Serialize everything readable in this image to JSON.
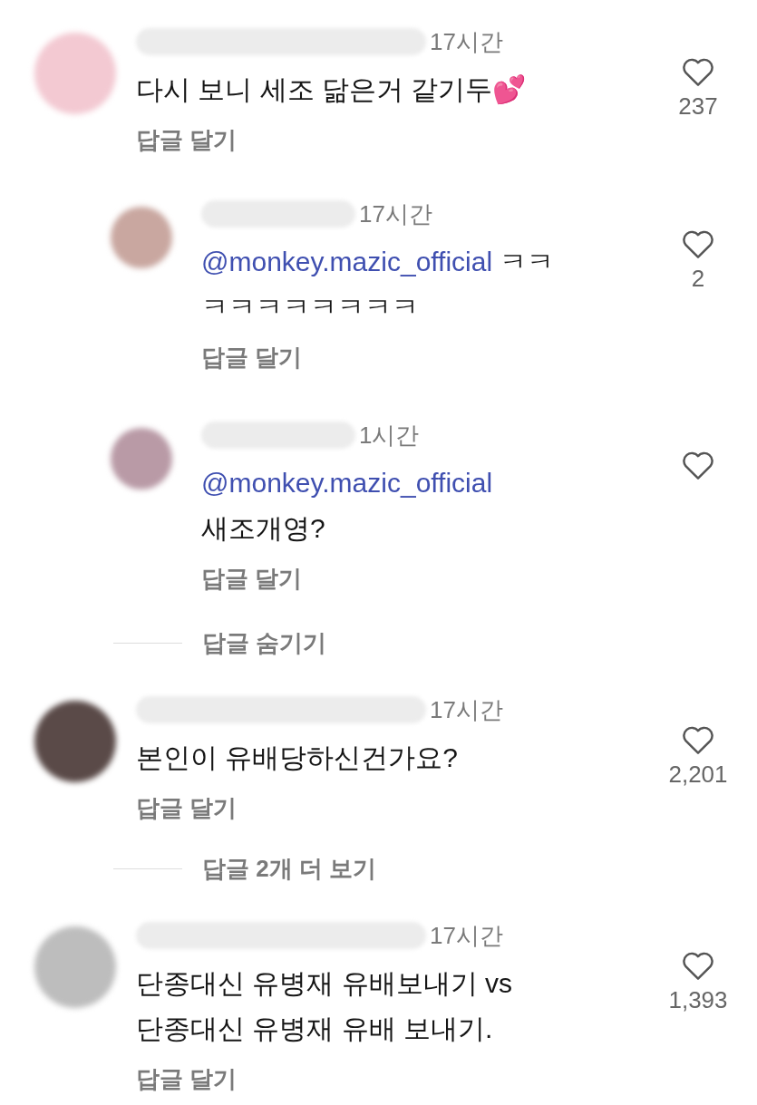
{
  "comments": [
    {
      "time": "17시간",
      "lines": [
        [
          {
            "kind": "text",
            "text": "다시 보니 세조 닮은거 같기두💕"
          }
        ]
      ],
      "likes": "237",
      "reply_label": "답글 달기",
      "replies": [
        {
          "time": "17시간",
          "lines": [
            [
              {
                "kind": "mention",
                "text": "@monkey.mazic_official"
              },
              {
                "kind": "text",
                "text": " ㅋㅋ"
              }
            ],
            [
              {
                "kind": "text",
                "text": "ㅋㅋㅋㅋㅋㅋㅋㅋ"
              }
            ]
          ],
          "likes": "2",
          "reply_label": "답글 달기"
        },
        {
          "time": "1시간",
          "lines": [
            [
              {
                "kind": "mention",
                "text": "@monkey.mazic_official"
              }
            ],
            [
              {
                "kind": "text",
                "text": "새조개영?"
              }
            ]
          ],
          "reply_label": "답글 달기"
        }
      ],
      "thread_link": "답글 숨기기"
    },
    {
      "time": "17시간",
      "lines": [
        [
          {
            "kind": "text",
            "text": "본인이 유배당하신건가요?"
          }
        ]
      ],
      "likes": "2,201",
      "reply_label": "답글 달기",
      "thread_link": "답글 2개 더 보기"
    },
    {
      "time": "17시간",
      "lines": [
        [
          {
            "kind": "text",
            "text": "단종대신 유병재 유배보내기 vs"
          }
        ],
        [
          {
            "kind": "text",
            "text": "단종대신 유병재 유배 보내기."
          }
        ]
      ],
      "likes": "1,393",
      "reply_label": "답글 달기"
    }
  ]
}
